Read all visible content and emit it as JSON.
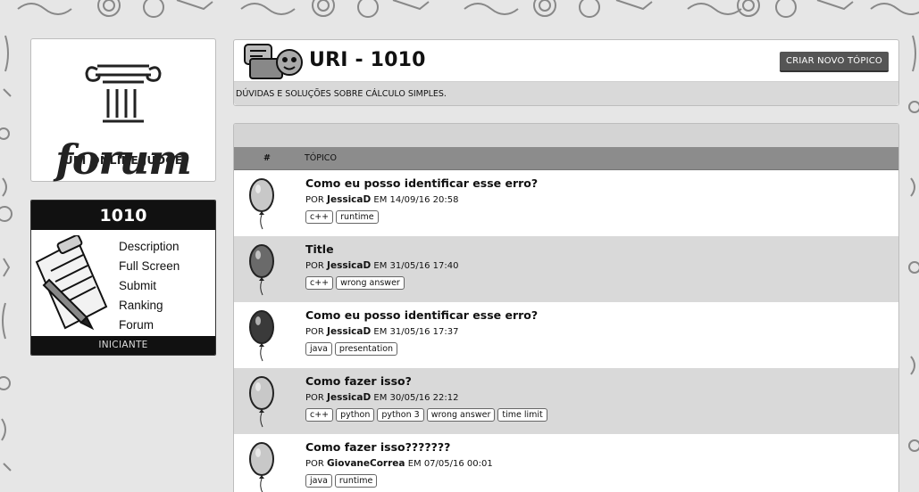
{
  "logo": {
    "word": "forum",
    "subtitle": "URI ONLINE JUDGE"
  },
  "problem": {
    "number": "1010",
    "menu": [
      "Description",
      "Full Screen",
      "Submit",
      "Ranking",
      "Forum"
    ],
    "level": "INICIANTE"
  },
  "header": {
    "title": "URI - 1010",
    "new_topic_label": "CRIAR NOVO TÓPICO",
    "description": "DÚVIDAS E SOLUÇÕES SOBRE CÁLCULO SIMPLES."
  },
  "table": {
    "col_hash": "#",
    "col_topic": "TÓPICO"
  },
  "topics": [
    {
      "title": "Como eu posso identificar esse erro?",
      "by": "POR",
      "author": "JessicaD",
      "at": "EM 14/09/16 20:58",
      "tags": [
        "c++",
        "runtime"
      ],
      "balloon_color": "#c8c8c8"
    },
    {
      "title": "Title",
      "by": "POR",
      "author": "JessicaD",
      "at": "EM 31/05/16 17:40",
      "tags": [
        "c++",
        "wrong answer"
      ],
      "balloon_color": "#6a6a6a"
    },
    {
      "title": "Como eu posso identificar esse erro?",
      "by": "POR",
      "author": "JessicaD",
      "at": "EM 31/05/16 17:37",
      "tags": [
        "java",
        "presentation"
      ],
      "balloon_color": "#3a3a3a"
    },
    {
      "title": "Como fazer isso?",
      "by": "POR",
      "author": "JessicaD",
      "at": "EM 30/05/16 22:12",
      "tags": [
        "c++",
        "python",
        "python 3",
        "wrong answer",
        "time limit"
      ],
      "balloon_color": "#c8c8c8"
    },
    {
      "title": "Como fazer isso???????",
      "by": "POR",
      "author": "GiovaneCorrea",
      "at": "EM 07/05/16 00:01",
      "tags": [
        "java",
        "runtime"
      ],
      "balloon_color": "#c8c8c8"
    }
  ],
  "colors": {
    "background": "#e6e6e6",
    "alt_row": "#d9d9d9",
    "header_bar": "#8c8c8c",
    "dark_bar": "#111111"
  }
}
